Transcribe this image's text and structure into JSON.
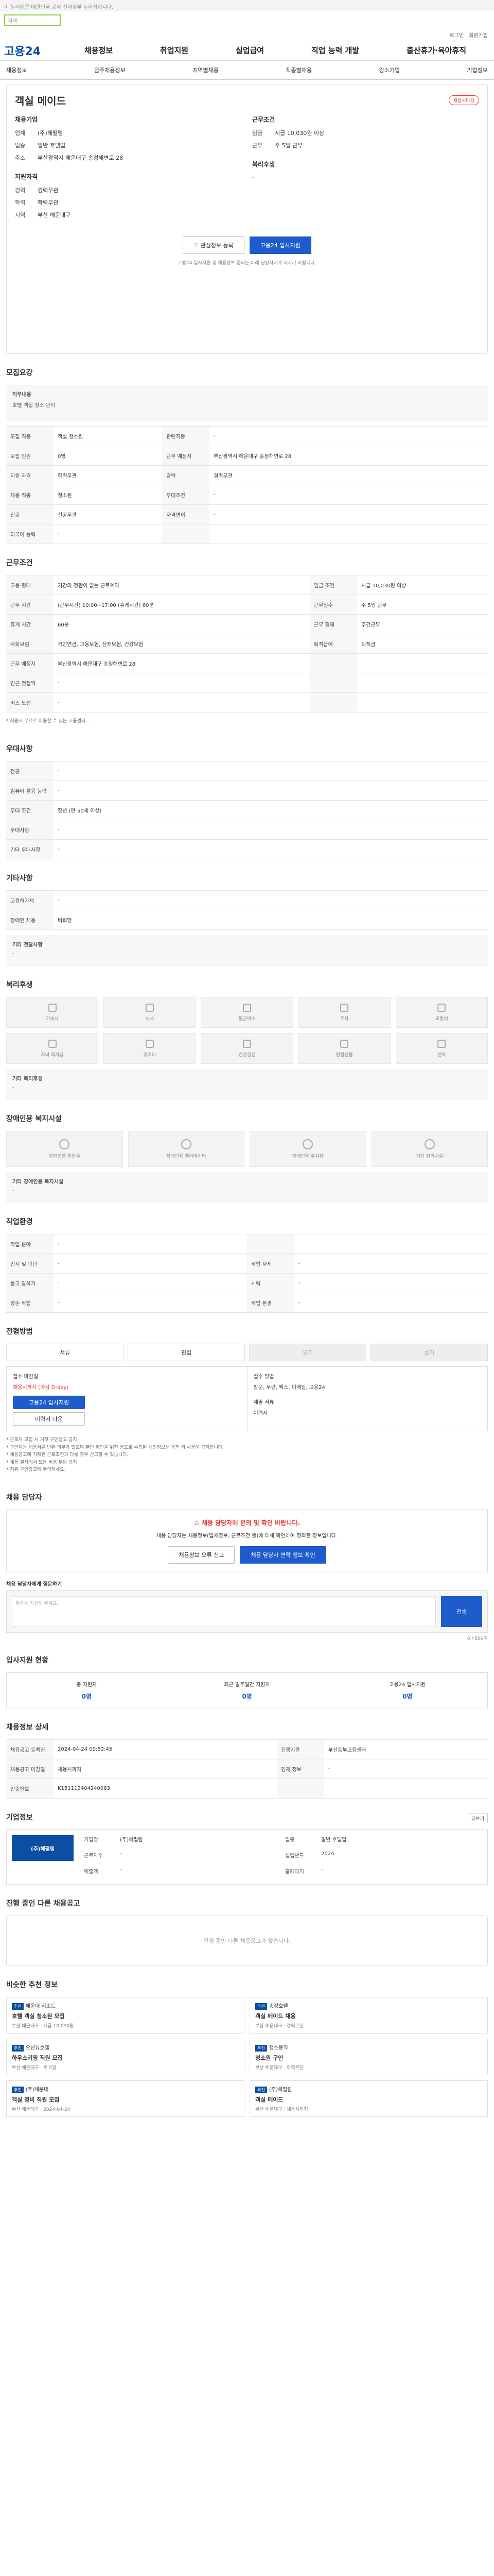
{
  "topbar_text": "이 누리집은 대한민국 공식 전자정부 누리집입니다.",
  "search_placeholder": "검색",
  "utility": [
    "로그인",
    "회원가입"
  ],
  "logo": "고용24",
  "gnb": [
    "채용정보",
    "취업지원",
    "실업급여",
    "직업 능력 개발",
    "출산휴가·육아휴직"
  ],
  "lnb": [
    "채용정보",
    "금주채용정보",
    "지역별채용",
    "직종별채용",
    "강소기업",
    "기업정보"
  ],
  "job": {
    "title": "객실 메이드",
    "badge": "채용시마감",
    "company_head": "채용기업",
    "company": [
      {
        "k": "업체",
        "v": "(주)헤펄림"
      },
      {
        "k": "업종",
        "v": "일반 호텔업"
      },
      {
        "k": "주소",
        "v": "부산광역시 해운대구 송정해변로 28"
      }
    ],
    "cond_head": "지원자격",
    "cond": [
      {
        "k": "경력",
        "v": "경력무관"
      },
      {
        "k": "학력",
        "v": "학력무관"
      },
      {
        "k": "지역",
        "v": "부산 해운대구"
      }
    ],
    "work_head": "근무조건",
    "work": [
      {
        "k": "임금",
        "v": "시급 10,030원 이상"
      },
      {
        "k": "근무",
        "v": "주 5일 근무"
      }
    ],
    "welfare_head": "복리후생",
    "welfare": [
      {
        "k": "",
        "v": "-"
      }
    ],
    "btn_save": "관심정보 등록",
    "btn_apply": "고용24 입사지원",
    "small_notice": "고용24 입사지원 및 채용정보 문의는 아래 담당자에게 하시기 바랍니다."
  },
  "sections": {
    "recruit": "모집요강",
    "work": "근무조건",
    "preference": "우대사항",
    "etc": "기타사항",
    "welfare": "복리후생",
    "disability": "장애인용 복지시설",
    "workplace": "작업환경",
    "process": "전형방법",
    "manager": "채용 담당자",
    "status": "입사지원 현황",
    "info": "채용정보 상세",
    "company": "기업정보",
    "other": "진행 중인 다른 채용공고",
    "recommend": "비슷한 추천 정보"
  },
  "recruit_desc": {
    "label": "직무내용",
    "value": "호텔 객실 청소 관리"
  },
  "recruit_table": [
    {
      "k": "모집 직종",
      "v": "객실 청소원",
      "k2": "관련직종",
      "v2": "-"
    },
    {
      "k": "모집 인원",
      "v": "0명",
      "k2": "근무 예정지",
      "v2": "부산광역시 해운대구 송정해변로 28"
    },
    {
      "k": "지원 자격",
      "v": "학력무관",
      "k2": "경력",
      "v2": "경력무관"
    },
    {
      "k": "채용 직종",
      "v": "청소원",
      "k2": "우대조건",
      "v2": "-"
    },
    {
      "k": "전공",
      "v": "전공무관",
      "k2": "자격면허",
      "v2": "-"
    },
    {
      "k": "외국어 능력",
      "v": "-",
      "k2": "",
      "v2": ""
    }
  ],
  "work_table": [
    {
      "k": "고용 형태",
      "v": "기간의 정함이 없는 근로계약",
      "k2": "임금 조건",
      "v2": "시급 10,030원 이상"
    },
    {
      "k": "근무 시간",
      "v": "(근무시간) 10:00~17:00 (휴게시간) 60분",
      "k2": "근무일수",
      "v2": "주 5일 근무"
    },
    {
      "k": "휴게 시간",
      "v": "60분",
      "k2": "근무 형태",
      "v2": "주간근무"
    },
    {
      "k": "사회보험",
      "v": "국민연금, 고용보험, 산재보험, 건강보험",
      "k2": "퇴직급여",
      "v2": "퇴직금"
    },
    {
      "k": "근무 예정지",
      "v": "부산광역시 해운대구 송정해변로 28",
      "k2": "",
      "v2": ""
    },
    {
      "k": "인근 전철역",
      "v": "-",
      "k2": "",
      "v2": ""
    },
    {
      "k": "버스 노선",
      "v": "-",
      "k2": "",
      "v2": ""
    }
  ],
  "work_note": "* 지원시 무료로 이용할 수 있는 고용센터 ...",
  "pref_table": [
    {
      "k": "전공",
      "v": "-"
    },
    {
      "k": "컴퓨터 활용 능력",
      "v": "-"
    },
    {
      "k": "우대 조건",
      "v": "장년 (만 50세 이상)"
    },
    {
      "k": "우대사항",
      "v": "-"
    },
    {
      "k": "기타 우대사항",
      "v": "-"
    }
  ],
  "etc_table": [
    {
      "k": "고용허가제",
      "v": "-"
    },
    {
      "k": "장애인 채용",
      "v": "비희망"
    }
  ],
  "etc_note_label": "기타 전달사항",
  "etc_note": "-",
  "welfare_items": [
    "기숙사",
    "식사",
    "통근버스",
    "주차",
    "교통비",
    "자녀 학자금",
    "경조비",
    "건강검진",
    "명절선물",
    "연차"
  ],
  "welfare_etc_label": "기타 복리후생",
  "welfare_etc": "-",
  "disability_items": [
    "장애인용 화장실",
    "장애인용 엘리베이터",
    "장애인용 주차장",
    "기타 편의시설"
  ],
  "disability_etc_label": "기타 장애인용 복지시설",
  "disability_etc": "-",
  "workplace_table": [
    {
      "k": "작업 분야",
      "v": "-",
      "k2": "",
      "v2": ""
    },
    {
      "k": "인지 및 판단",
      "v": "-",
      "k2": "작업 자세",
      "v2": "-"
    },
    {
      "k": "듣고 말하기",
      "v": "-",
      "k2": "시력",
      "v2": "-"
    },
    {
      "k": "양손 작업",
      "v": "-",
      "k2": "작업 환경",
      "v2": "-"
    }
  ],
  "process_steps": [
    "서류",
    "면접",
    "필기",
    "실기"
  ],
  "apply": {
    "col1_head": "접수 마감일",
    "col1_value": "채용시까지 (마감 D-day)",
    "col1_btn": "고용24 입사지원",
    "col1_btn2": "이력서 다운",
    "col2_head": "접수 방법",
    "col2_value": "방문, 우편, 팩스, 이메일, 고용24",
    "col2_head2": "제출 서류",
    "col2_value2": "이력서"
  },
  "notes": [
    "* 근로자 모집 시 거짓 구인광고 금지",
    "* 구인자는 채용서류 반환 의무가 있으며 본인 확인을 위한 용도로 수집된 개인정보는 목적 외 사용이 금지됩니다.",
    "* 채용공고에 기재된 근로조건과 다를 경우 신고할 수 있습니다.",
    "* 채용 절차에서 모든 비용 부담 금지",
    "* 허위 구인광고에 주의하세요."
  ],
  "warn": {
    "title": "채용 담당자에 문의 및 확인 바랍니다.",
    "text": "채용 담당자는 채용정보(업체정보, 근로조건 등)에 대해 확인하여 정확한 정보입니다.",
    "btn1": "채용정보 오류 신고",
    "btn2": "채용 담당자 연락 정보 확인"
  },
  "qa": {
    "label": "채용 담당자에게 질문하기",
    "placeholder": "질문을 작성해 주세요.",
    "btn": "전송",
    "count": "0 / 500자"
  },
  "stats": [
    {
      "label": "총 지원자",
      "value": "0명"
    },
    {
      "label": "최근 일주일간 지원자",
      "value": "0명"
    },
    {
      "label": "고용24 입사지원",
      "value": "0명"
    }
  ],
  "info_table": [
    {
      "k": "채용공고 등록일",
      "v": "2024-04-24 09:52:45",
      "k2": "진행기관",
      "v2": "부산동부고용센터"
    },
    {
      "k": "채용공고 마감일",
      "v": "채용시까지",
      "k2": "인재 정보",
      "v2": "-"
    },
    {
      "k": "인증번호",
      "v": "K151112404240063",
      "k2": "",
      "v2": ""
    }
  ],
  "company_info": {
    "logo": "(주)헤펄림",
    "fields": [
      {
        "k": "기업명",
        "v": "(주)헤펄림"
      },
      {
        "k": "업종",
        "v": "일반 호텔업"
      },
      {
        "k": "근로자수",
        "v": "-"
      },
      {
        "k": "설립년도",
        "v": "2024"
      },
      {
        "k": "매출액",
        "v": "-"
      },
      {
        "k": "홈페이지",
        "v": "-"
      }
    ]
  },
  "other_empty": "진행 중인 다른 채용공고가 없습니다.",
  "more": "더보기",
  "recommends": [
    {
      "badge": "추천",
      "co": "해운대 리조트",
      "title": "호텔 객실 청소원 모집",
      "meta": "부산 해운대구 · 시급 10,030원"
    },
    {
      "badge": "추천",
      "co": "송정호텔",
      "title": "객실 메이드 채용",
      "meta": "부산 해운대구 · 경력무관"
    },
    {
      "badge": "추천",
      "co": "오션뷰호텔",
      "title": "하우스키핑 직원 모집",
      "meta": "부산 해운대구 · 주 5일"
    },
    {
      "badge": "추천",
      "co": "청소용역",
      "title": "청소원 구인",
      "meta": "부산 해운대구 · 학력무관"
    },
    {
      "badge": "추천",
      "co": "(주)해운대",
      "title": "객실 정비 직원 모집",
      "meta": "부산 해운대구 · 2024-04-24"
    },
    {
      "badge": "추천",
      "co": "(주)헤펄림",
      "title": "객실 메이드",
      "meta": "부산 해운대구 · 채용시까지"
    }
  ]
}
